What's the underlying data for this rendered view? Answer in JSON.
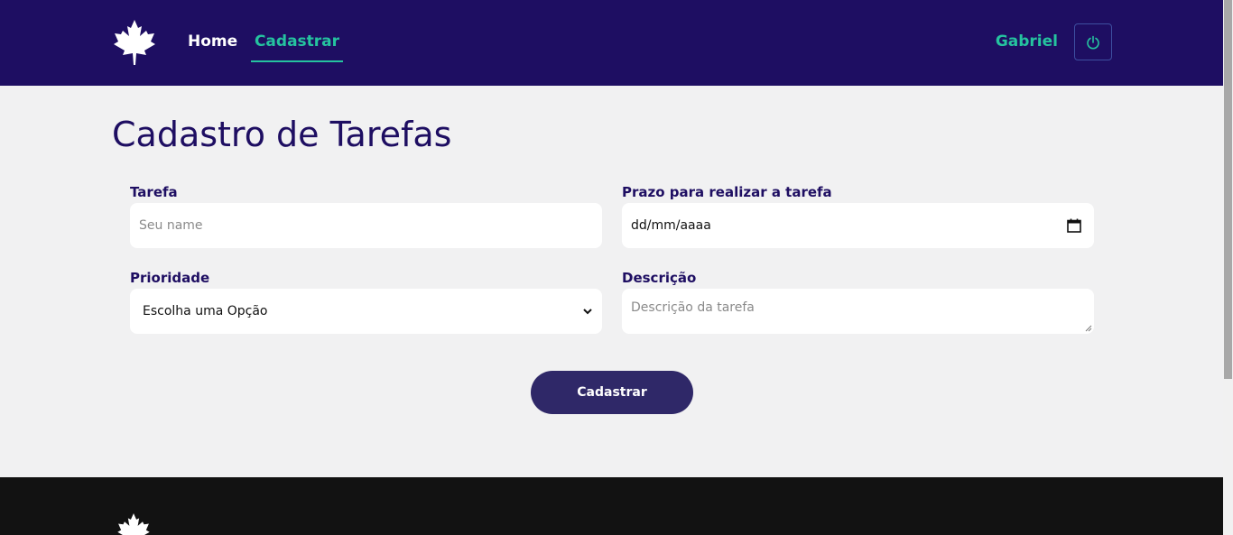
{
  "navbar": {
    "logo_icon": "maple-leaf-icon",
    "links": [
      {
        "label": "Home",
        "active": false
      },
      {
        "label": "Cadastrar",
        "active": true
      }
    ],
    "user_name": "Gabriel",
    "logout_icon": "power-icon"
  },
  "page": {
    "title": "Cadastro de Tarefas"
  },
  "form": {
    "task": {
      "label": "Tarefa",
      "placeholder": "Seu name"
    },
    "deadline": {
      "label": "Prazo para realizar a tarefa",
      "value": "dd/mm/aaaa"
    },
    "priority": {
      "label": "Prioridade",
      "selected": "Escolha uma Opção"
    },
    "description": {
      "label": "Descrição",
      "placeholder": "Descrição da tarefa"
    },
    "submit_label": "Cadastrar"
  },
  "footer": {
    "logo_icon": "maple-leaf-icon"
  },
  "colors": {
    "navbar_bg": "#1e0e62",
    "accent": "#25c39f",
    "button_bg": "#2f2868",
    "footer_bg": "#121212",
    "page_bg": "#f1f1f2"
  }
}
